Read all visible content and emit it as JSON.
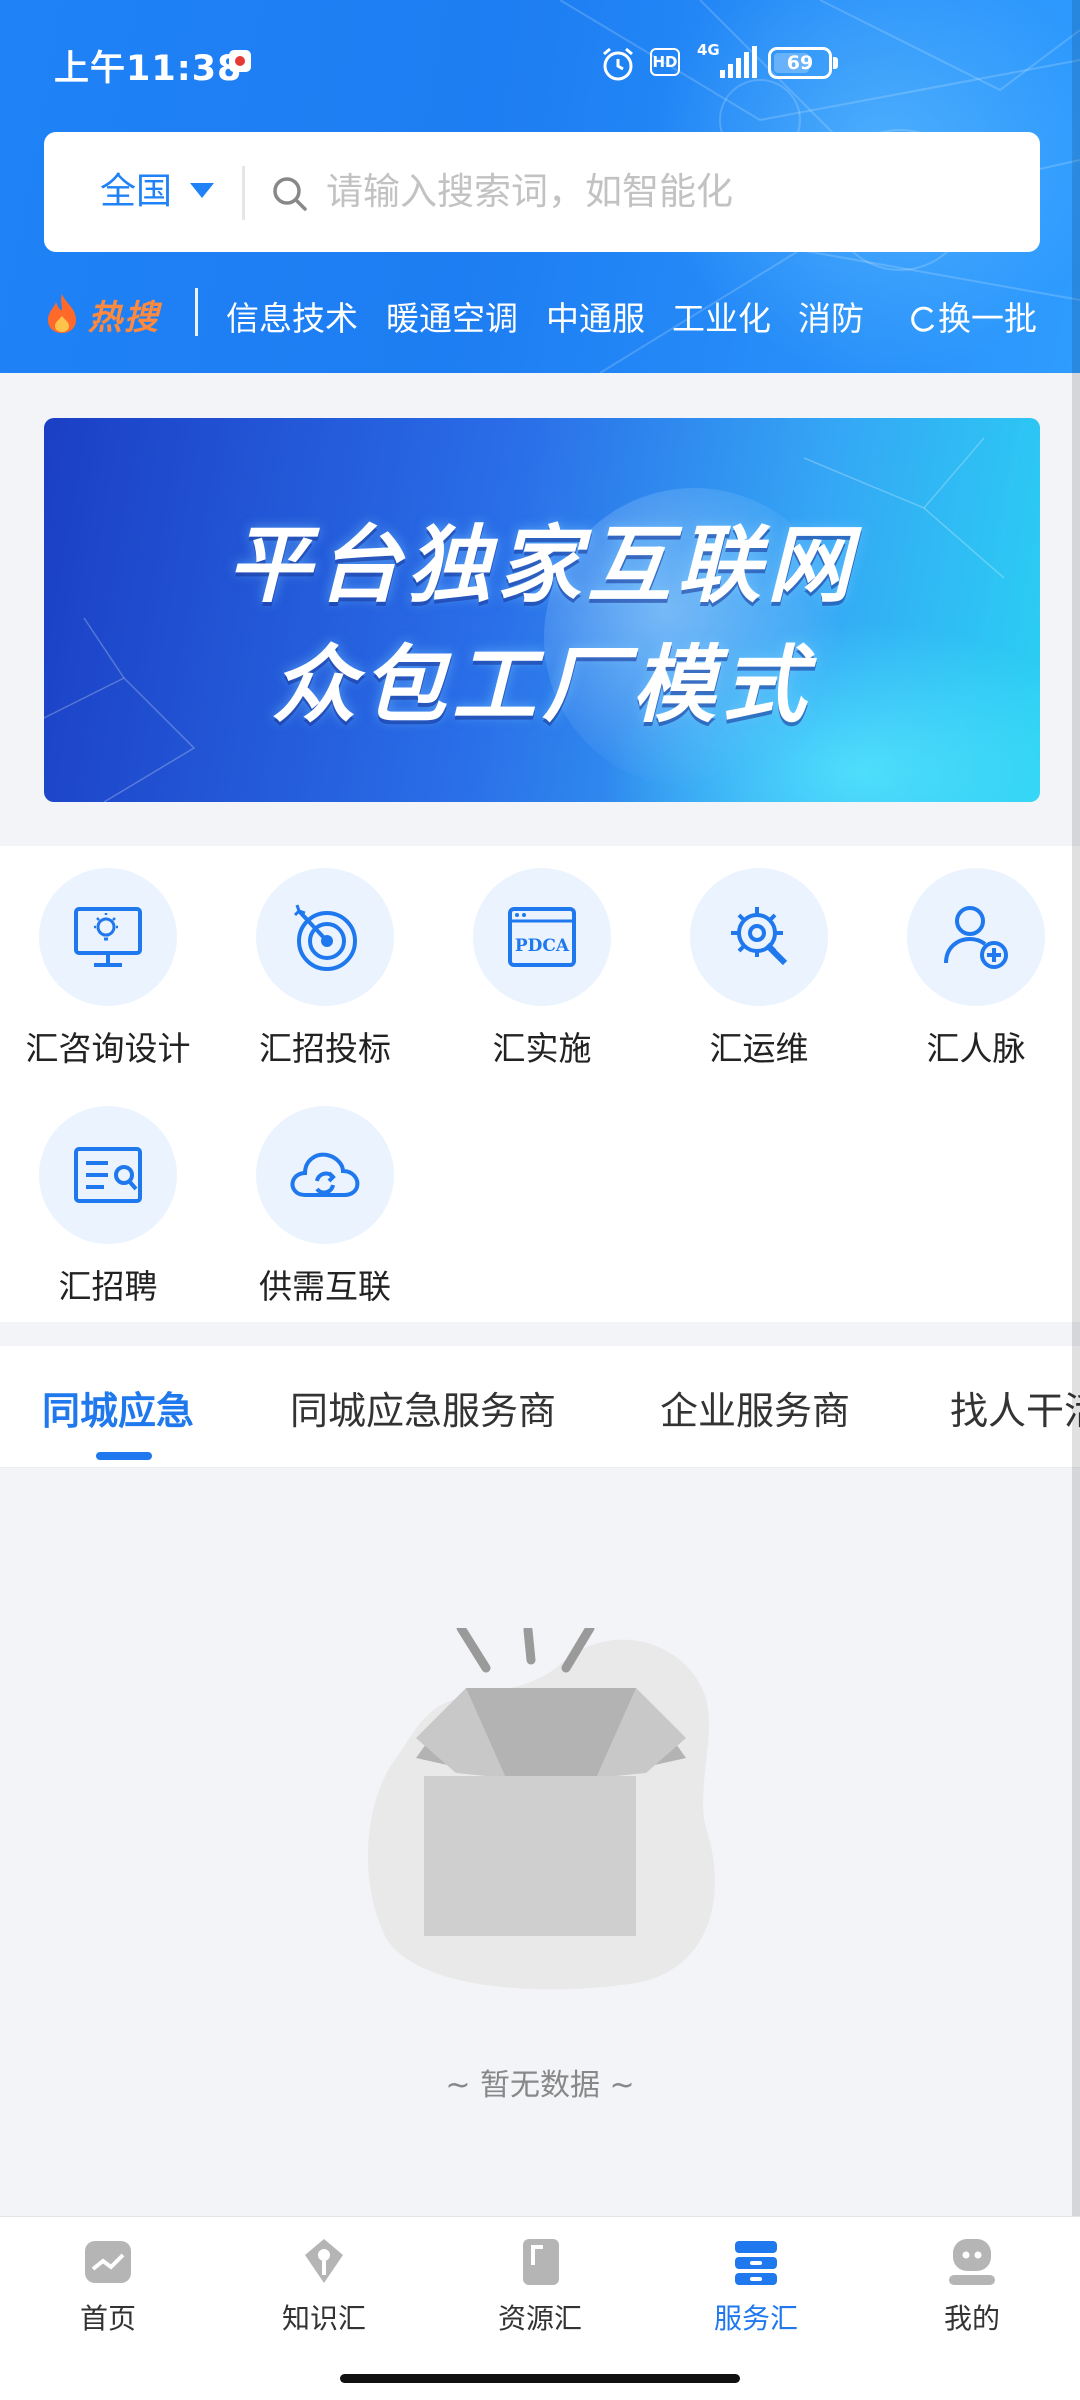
{
  "status_bar": {
    "time": "上午11:38",
    "hd_label": "HD",
    "network_label": "4G",
    "battery_level": "69"
  },
  "search": {
    "region": "全国",
    "placeholder": "请输入搜索词，如智能化"
  },
  "hot_search": {
    "label": "热搜",
    "keywords": [
      "信息技术",
      "暖通空调",
      "中通服",
      "工业化",
      "消防"
    ],
    "refresh_label": "换一批"
  },
  "banner": {
    "line1": "平台独家互联网",
    "line2": "众包工厂模式"
  },
  "services": [
    {
      "label": "汇咨询设计",
      "icon": "monitor-lightbulb-icon"
    },
    {
      "label": "汇招投标",
      "icon": "target-icon"
    },
    {
      "label": "汇实施",
      "icon": "pdca-icon"
    },
    {
      "label": "汇运维",
      "icon": "gear-wrench-icon"
    },
    {
      "label": "汇人脉",
      "icon": "add-person-icon"
    },
    {
      "label": "汇招聘",
      "icon": "resume-icon"
    },
    {
      "label": "供需互联",
      "icon": "cloud-sync-icon"
    }
  ],
  "tabs": [
    "同城应急",
    "同城应急服务商",
    "企业服务商",
    "找人干活"
  ],
  "active_tab": "同城应急",
  "empty_state": {
    "text": "~ 暂无数据 ~"
  },
  "bottom_nav": [
    {
      "label": "首页",
      "icon": "home-chart-icon"
    },
    {
      "label": "知识汇",
      "icon": "knowledge-pin-icon"
    },
    {
      "label": "资源汇",
      "icon": "resource-book-icon"
    },
    {
      "label": "服务汇",
      "icon": "service-box-icon"
    },
    {
      "label": "我的",
      "icon": "profile-icon"
    }
  ],
  "active_nav": "服务汇",
  "colors": {
    "brand_blue": "#1f82f6",
    "active_blue": "#1f78ee",
    "hot_orange": "#ff8a3d",
    "icon_circle_bg": "#eaf3fe"
  }
}
